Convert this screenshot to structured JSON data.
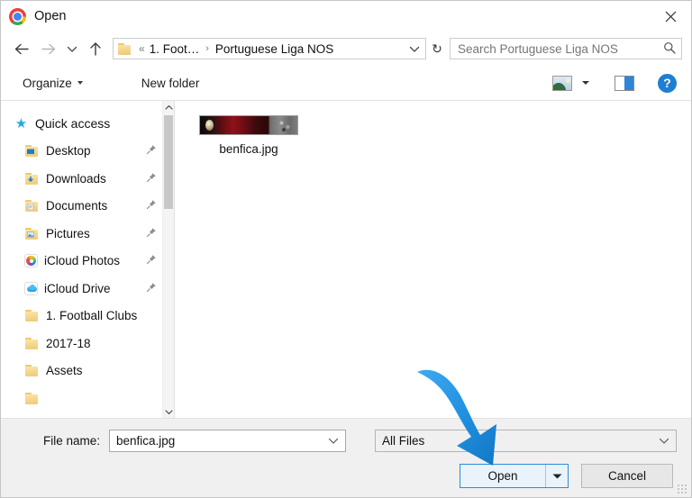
{
  "window": {
    "title": "Open",
    "app_icon": "chrome-logo-icon",
    "close_label": "✕"
  },
  "nav": {
    "back_icon": "arrow-left-icon",
    "forward_icon": "arrow-right-icon",
    "recent_icon": "chevron-down-icon",
    "up_icon": "arrow-up-icon",
    "refresh_icon": "refresh-icon",
    "refresh_glyph": "↻",
    "breadcrumb": {
      "folder_icon": "folder-icon",
      "overflow": "«",
      "items": [
        "1. Foot…",
        "Portuguese Liga NOS"
      ],
      "separator": "›",
      "dropdown_icon": "chevron-down-icon"
    },
    "search": {
      "placeholder": "Search Portuguese Liga NOS",
      "value": "",
      "icon": "search-icon"
    }
  },
  "command_bar": {
    "organize_label": "Organize",
    "organize_caret_icon": "caret-down-icon",
    "new_folder_label": "New folder",
    "view_icon": "view-large-icons-icon",
    "view_caret_icon": "caret-down-icon",
    "preview_pane_icon": "preview-pane-icon",
    "help_icon": "help-icon",
    "help_label": "?"
  },
  "sidebar": {
    "items": [
      {
        "label": "Quick access",
        "icon": "star-icon",
        "type": "root",
        "pinned": false
      },
      {
        "label": "Desktop",
        "icon": "folder-desktop-icon",
        "type": "child",
        "pinned": true
      },
      {
        "label": "Downloads",
        "icon": "folder-downloads-icon",
        "type": "child",
        "pinned": true
      },
      {
        "label": "Documents",
        "icon": "folder-documents-icon",
        "type": "child",
        "pinned": true
      },
      {
        "label": "Pictures",
        "icon": "folder-pictures-icon",
        "type": "child",
        "pinned": true
      },
      {
        "label": "iCloud Photos",
        "icon": "icloud-photos-icon",
        "type": "child",
        "pinned": true
      },
      {
        "label": "iCloud Drive",
        "icon": "icloud-drive-icon",
        "type": "child",
        "pinned": true
      },
      {
        "label": "1. Football Clubs",
        "icon": "folder-icon",
        "type": "child",
        "pinned": false
      },
      {
        "label": "2017-18",
        "icon": "folder-icon",
        "type": "child",
        "pinned": false
      },
      {
        "label": "Assets",
        "icon": "folder-icon",
        "type": "child",
        "pinned": false
      }
    ],
    "pin_icon": "pin-icon",
    "scrollbar": {
      "up_icon": "chevron-up-icon",
      "down_icon": "chevron-down-icon"
    }
  },
  "files": {
    "items": [
      {
        "name": "benfica.jpg",
        "icon": "image-thumbnail"
      }
    ]
  },
  "footer": {
    "file_name_label": "File name:",
    "file_name_value": "benfica.jpg",
    "file_name_dropdown_icon": "chevron-down-icon",
    "file_type_value": "All Files",
    "file_type_dropdown_icon": "chevron-down-icon",
    "open_label": "Open",
    "open_caret_icon": "caret-down-icon",
    "cancel_label": "Cancel",
    "resize_grip_icon": "resize-grip-icon"
  },
  "annotation": {
    "arrow_icon": "blue-curved-arrow",
    "color": "#2196e8",
    "points_to": "open-button"
  },
  "colors": {
    "accent": "#2e8ad4",
    "annotation_blue": "#2196e8",
    "folder_yellow": "#f4d58d",
    "window_bg": "#ffffff",
    "footer_bg": "#f0f0f0"
  }
}
